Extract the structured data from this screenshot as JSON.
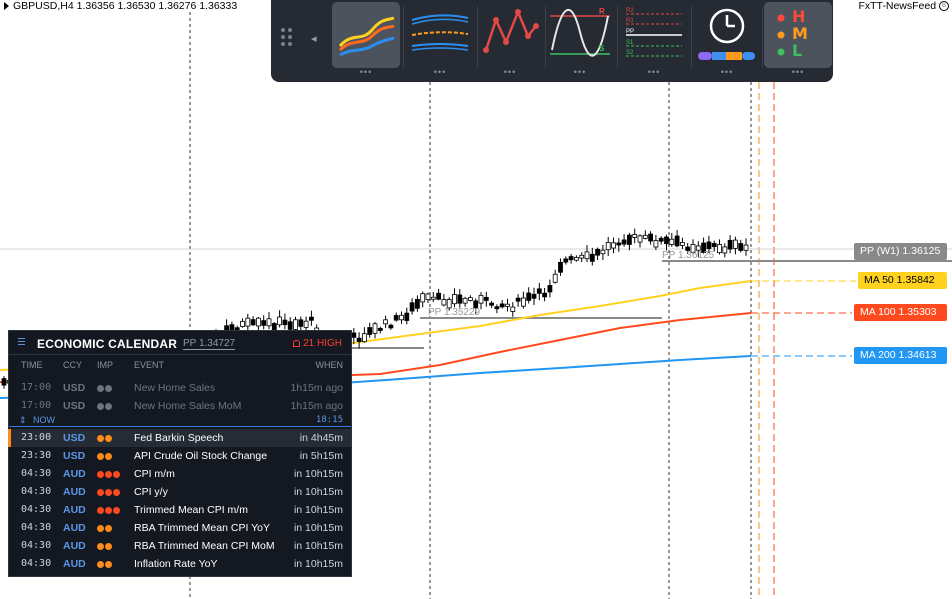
{
  "header": {
    "symbol_quote": "GBPUSD,H4  1.36356 1.36530 1.36276 1.36333",
    "newsfeed": "FxTT-NewsFeed"
  },
  "toolbar": {
    "buttons": [
      {
        "name": "moving-averages-tool",
        "icon": "ma-lines-icon"
      },
      {
        "name": "bands-tool",
        "icon": "bands-icon"
      },
      {
        "name": "zigzag-tool",
        "icon": "zigzag-icon"
      },
      {
        "name": "support-resistance-tool",
        "icon": "sr-wave-icon"
      },
      {
        "name": "pivot-points-tool",
        "icon": "pivot-levels-icon"
      },
      {
        "name": "sessions-clock-tool",
        "icon": "clock-icon"
      },
      {
        "name": "hml-tool",
        "icon": "hml-icon"
      }
    ],
    "sr_labels": {
      "r": "R",
      "s": "S"
    },
    "pivot_labels": {
      "r2": "R2",
      "r1": "R1",
      "pp": "PP",
      "s1": "S1",
      "s2": "S2"
    },
    "hml_labels": {
      "h": "H",
      "m": "M",
      "l": "L"
    },
    "more": "•••"
  },
  "price_tags": {
    "pp_w1": "PP (W1)  1.36125",
    "ma50": "MA 50  1.35842",
    "ma100": "MA 100  1.35303",
    "ma200": "MA 200  1.34613"
  },
  "chart_labels": {
    "pp_w1_inline": "PP  1.36125",
    "pp_left_inline": "PP  1.35229"
  },
  "colors": {
    "ma50": "#ffd21f",
    "ma100": "#ff4a1f",
    "ma200": "#2196f3",
    "pp": "#898989",
    "impact_low": "#6d7480",
    "impact_medium": "#ff8c1a",
    "impact_high": "#ff4a1f"
  },
  "calendar": {
    "title": "ECONOMIC CALENDAR",
    "pp": "PP  1.34727",
    "alert": "21 HIGH",
    "columns": {
      "time": "TIME",
      "ccy": "CCY",
      "imp": "IMP",
      "event": "EVENT",
      "when": "WHEN"
    },
    "now_label": "NOW",
    "now_time": "18:15",
    "past": [
      {
        "time": "17:00",
        "ccy": "USD",
        "impact": 2,
        "event": "New Home Sales",
        "when": "1h15m ago"
      },
      {
        "time": "17:00",
        "ccy": "USD",
        "impact": 2,
        "event": "New Home Sales MoM",
        "when": "1h15m ago"
      }
    ],
    "upcoming": [
      {
        "time": "23:00",
        "ccy": "USD",
        "impact": 2,
        "level": "medium",
        "event": "Fed Barkin Speech",
        "when": "in 4h45m"
      },
      {
        "time": "23:30",
        "ccy": "USD",
        "impact": 2,
        "level": "medium",
        "event": "API Crude Oil Stock Change",
        "when": "in 5h15m"
      },
      {
        "time": "04:30",
        "ccy": "AUD",
        "impact": 3,
        "level": "high",
        "event": "CPI m/m",
        "when": "in 10h15m"
      },
      {
        "time": "04:30",
        "ccy": "AUD",
        "impact": 3,
        "level": "high",
        "event": "CPI y/y",
        "when": "in 10h15m"
      },
      {
        "time": "04:30",
        "ccy": "AUD",
        "impact": 3,
        "level": "high",
        "event": "Trimmed Mean CPI m/m",
        "when": "in 10h15m"
      },
      {
        "time": "04:30",
        "ccy": "AUD",
        "impact": 2,
        "level": "medium",
        "event": "RBA Trimmed Mean CPI YoY",
        "when": "in 10h15m"
      },
      {
        "time": "04:30",
        "ccy": "AUD",
        "impact": 2,
        "level": "medium",
        "event": "RBA Trimmed Mean CPI MoM",
        "when": "in 10h15m"
      },
      {
        "time": "04:30",
        "ccy": "AUD",
        "impact": 2,
        "level": "medium",
        "event": "Inflation Rate YoY",
        "when": "in 10h15m"
      }
    ]
  }
}
